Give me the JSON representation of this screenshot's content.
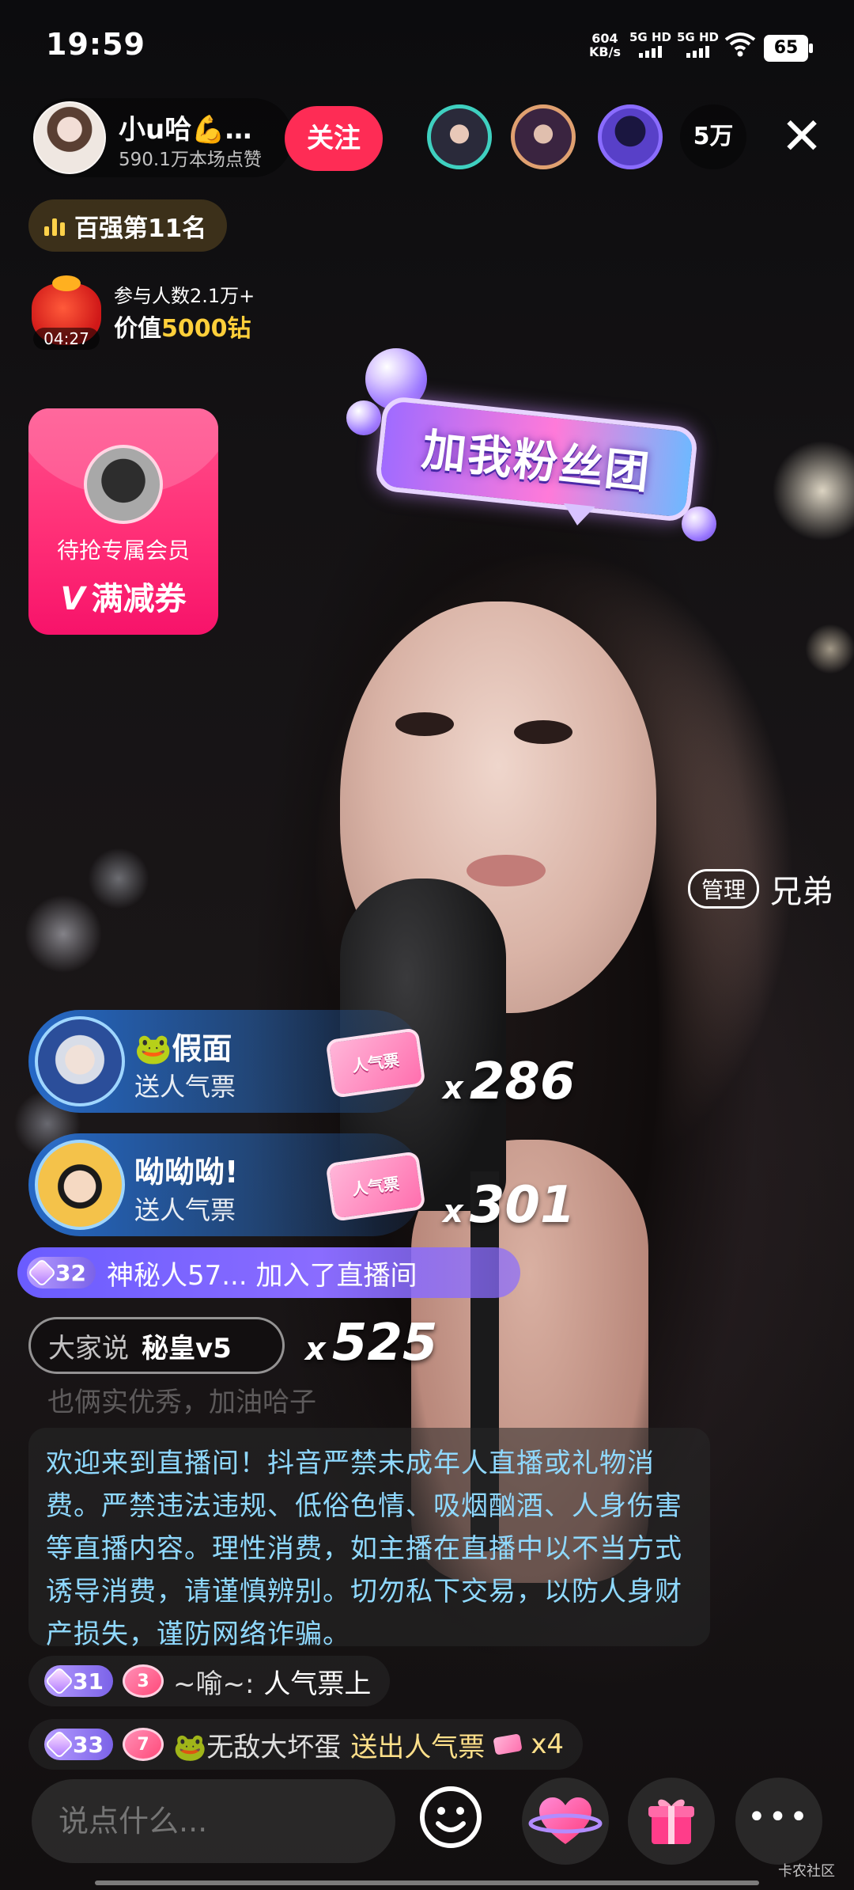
{
  "status_bar": {
    "time": "19:59",
    "net_speed_value": "604",
    "net_speed_unit": "KB/s",
    "signal1": "5G HD",
    "signal2": "5G HD",
    "battery": "65"
  },
  "anchor": {
    "name": "小u哈💪…",
    "likes": "590.1万本场点赞",
    "follow_label": "关注"
  },
  "viewers": {
    "count": "5万"
  },
  "rank": {
    "label": "百强第11名"
  },
  "lucky_bag": {
    "timer": "04:27",
    "participants": "参与人数2.1万+",
    "value_prefix": "价值",
    "value_amount": "5000钻"
  },
  "coupon": {
    "line1": "待抢专属会员",
    "v_mark": "V",
    "line2": "满减券"
  },
  "fan_club": {
    "label": "加我粉丝团"
  },
  "admin_entry": {
    "tag": "管理",
    "name": "兄弟"
  },
  "gifts": [
    {
      "user": "🐸假面",
      "desc": "送人气票",
      "ticket": "人气票",
      "x": "x",
      "count": "286"
    },
    {
      "user": "呦呦呦!",
      "desc": "送人气票",
      "ticket": "人气票",
      "x": "x",
      "count": "301"
    }
  ],
  "join_banner": {
    "level": "32",
    "text": "神秘人57... 加入了直播间"
  },
  "hot_chat": {
    "prefix": "大家说",
    "text": "秘皇v5",
    "x": "x",
    "count": "525"
  },
  "faded_message": "也俩实优秀，加油哈子",
  "notice": "欢迎来到直播间！抖音严禁未成年人直播或礼物消费。严禁违法违规、低俗色情、吸烟酗酒、人身伤害等直播内容。理性消费，如主播在直播中以不当方式诱导消费，请谨慎辨别。切勿私下交易，以防人身财产损失，谨防网络诈骗。",
  "messages": [
    {
      "level": "31",
      "fan_level": "3",
      "name": "~喻~:",
      "text": "人气票上"
    },
    {
      "level": "33",
      "fan_level": "7",
      "name": "🐸无敌大坏蛋",
      "text": "送出人气票",
      "suffix": "x4"
    }
  ],
  "bottom_bar": {
    "input_placeholder": "说点什么...",
    "more": "•••"
  },
  "watermark": "卡农社区",
  "colors": {
    "follow_red": "#fe2c55",
    "coupon_pink": "#ff2f77",
    "notice_blue": "#8fd9ff",
    "gold": "#ffcf3a",
    "level_purple": "#7b63e8"
  }
}
